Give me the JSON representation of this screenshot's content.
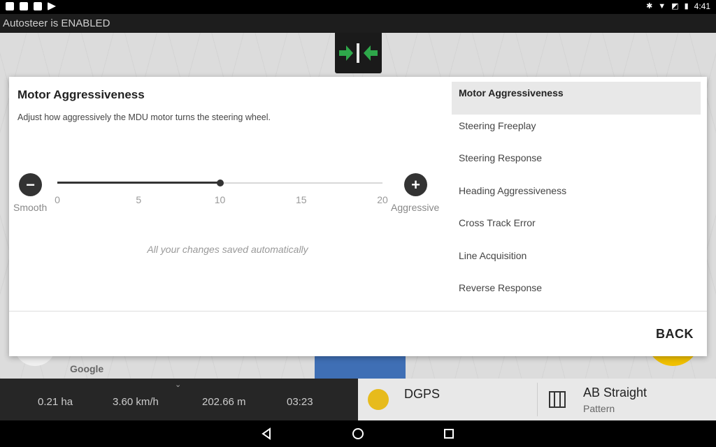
{
  "status_bar": {
    "time": "4:41",
    "left_icons": [
      "car-icon",
      "image-icon",
      "sim-icon",
      "play-store-icon"
    ],
    "right_icons": [
      "bluetooth-icon",
      "wifi-icon",
      "no-sim-icon",
      "battery-icon"
    ]
  },
  "banner": {
    "text": "Autosteer is ENABLED"
  },
  "map": {
    "attribution": "Google"
  },
  "dialog": {
    "title": "Motor Aggressiveness",
    "description": "Adjust how aggressively the MDU motor turns the steering wheel.",
    "slider": {
      "min_label": "Smooth",
      "max_label": "Aggressive",
      "min": 0,
      "max": 20,
      "value": 10,
      "ticks": [
        "0",
        "5",
        "10",
        "15",
        "20"
      ]
    },
    "saved_message": "All your changes saved automatically",
    "menu": [
      {
        "label": "Motor Aggressiveness",
        "active": true
      },
      {
        "label": "Steering Freeplay",
        "active": false
      },
      {
        "label": "Steering Response",
        "active": false
      },
      {
        "label": "Heading Aggressiveness",
        "active": false
      },
      {
        "label": "Cross Track Error",
        "active": false
      },
      {
        "label": "Line Acquisition",
        "active": false
      },
      {
        "label": "Reverse Response",
        "active": false
      }
    ],
    "back_label": "BACK"
  },
  "bottom": {
    "area": "0.21 ha",
    "speed": "3.60 km/h",
    "distance": "202.66 m",
    "time": "03:23",
    "gps_label": "DGPS",
    "gps_color": "#e7bb1c",
    "pattern_name": "AB Straight",
    "pattern_sub": "Pattern"
  },
  "colors": {
    "accent_arrow": "#2ea84a",
    "dialog_bg": "#ffffff",
    "menu_active_bg": "#e8e8e8"
  }
}
